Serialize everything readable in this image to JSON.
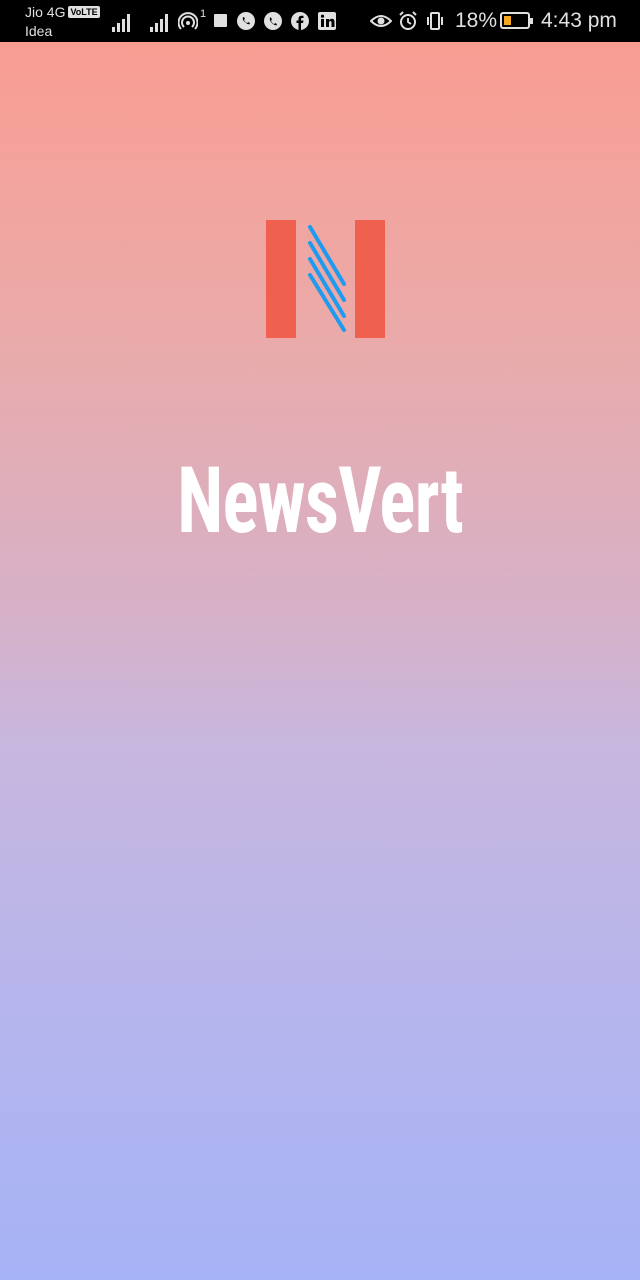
{
  "status_bar": {
    "carrier_primary": "Jio 4G",
    "volte_badge": "VoLTE",
    "carrier_secondary": "Idea",
    "hotspot_count": "1",
    "battery_percent": "18%",
    "time": "4:43 pm",
    "icons": [
      "signal-icon",
      "signal-icon",
      "hotspot-icon",
      "notification-square-icon",
      "whatsapp-icon",
      "phone-icon",
      "facebook-icon",
      "linkedin-icon",
      "eye-icon",
      "alarm-icon",
      "vibrate-icon",
      "battery-icon"
    ]
  },
  "splash": {
    "app_name": "NewsVert",
    "logo_colors": {
      "bars": "#f0604e",
      "stripes": "#1e9af0"
    }
  }
}
